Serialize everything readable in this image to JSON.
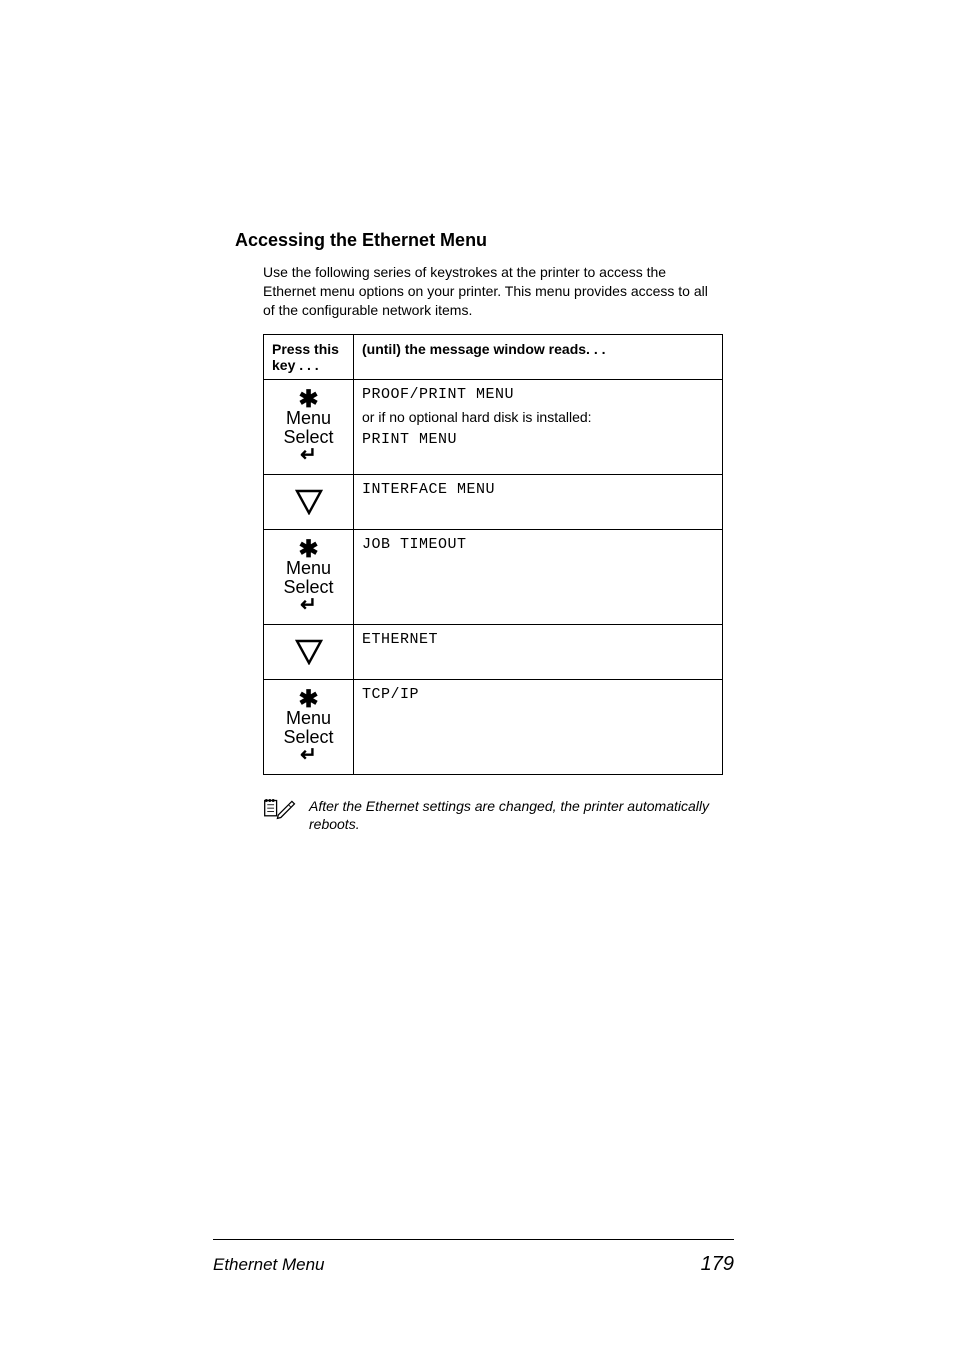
{
  "heading": "Accessing the Ethernet Menu",
  "intro": "Use the following series of keystrokes at the printer to access the Ethernet menu options on your printer. This menu provides access to all of the configurable network items.",
  "table": {
    "headers": {
      "col1": "Press this key . . .",
      "col2": "(until) the message window reads. . ."
    },
    "rows": {
      "r1": {
        "icon": {
          "menu": "Menu",
          "select": "Select"
        },
        "line1": "PROOF/PRINT MENU",
        "mid": "or if no optional hard disk is installed:",
        "line2": "PRINT MENU"
      },
      "r2": {
        "msg": "INTERFACE MENU"
      },
      "r3": {
        "icon": {
          "menu": "Menu",
          "select": "Select"
        },
        "msg": "JOB TIMEOUT"
      },
      "r4": {
        "msg": "ETHERNET"
      },
      "r5": {
        "icon": {
          "menu": "Menu",
          "select": "Select"
        },
        "msg": "TCP/IP"
      }
    }
  },
  "note": "After the Ethernet settings are changed, the printer automatically reboots.",
  "footer": {
    "title": "Ethernet Menu",
    "page": "179"
  }
}
